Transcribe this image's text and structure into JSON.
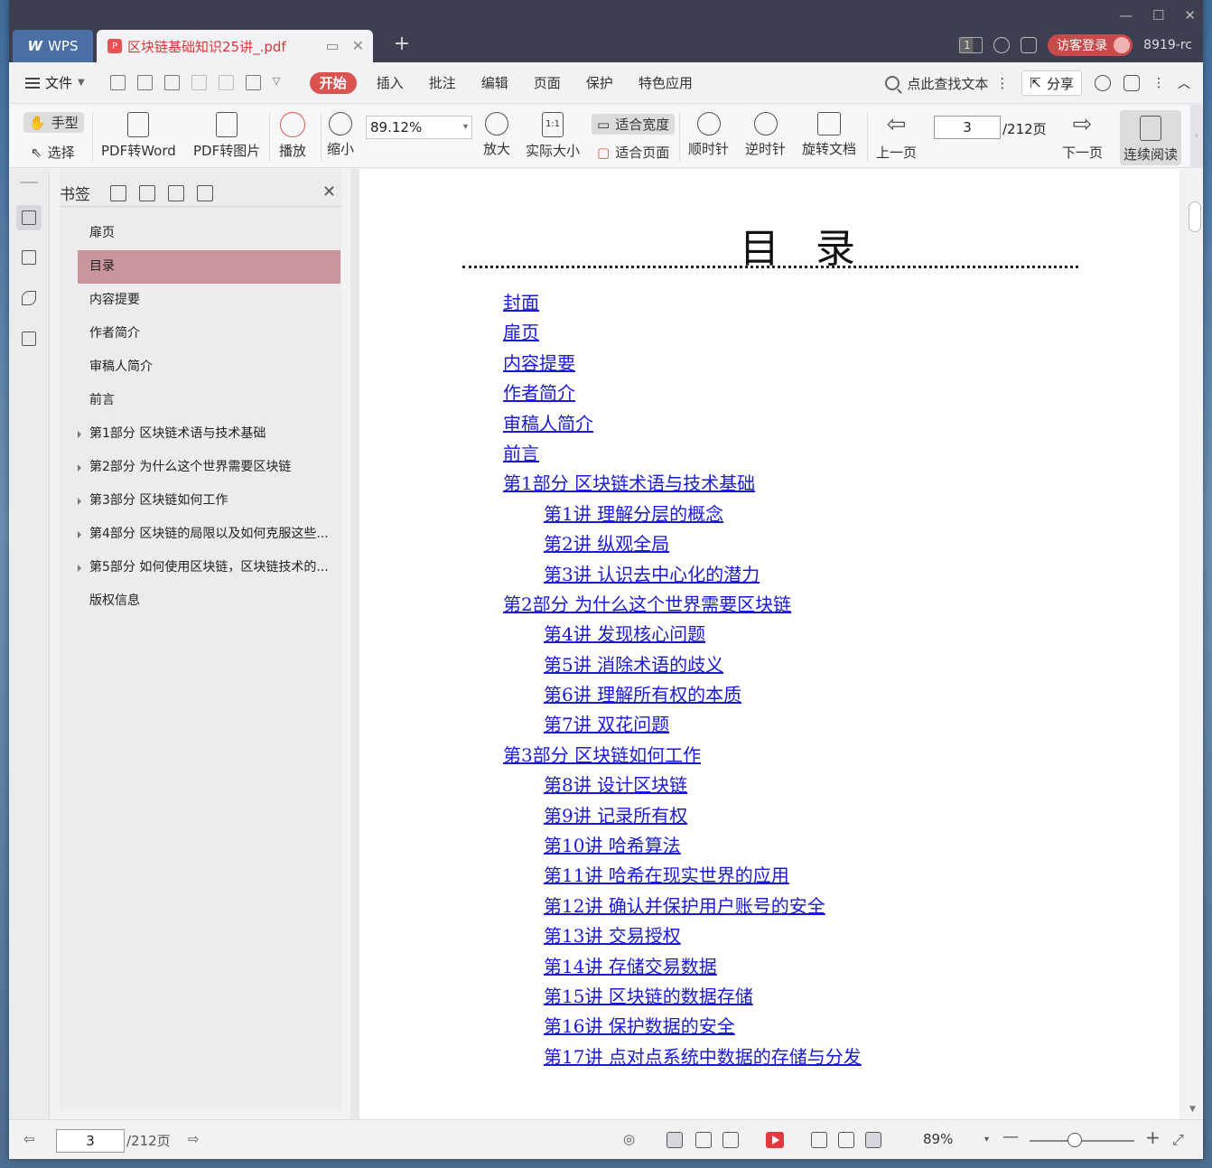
{
  "titlebar": {
    "app_tab": "WPS",
    "doc_tab": "区块链基础知识25讲_.pdf",
    "page_badge": "1",
    "login": "访客登录",
    "user": "8919-rc"
  },
  "menubar": {
    "file": "文件",
    "tabs": [
      "开始",
      "插入",
      "批注",
      "编辑",
      "页面",
      "保护",
      "特色应用"
    ],
    "find": "点此查找文本",
    "share": "分享"
  },
  "ribbon": {
    "hand": "手型",
    "select": "选择",
    "pdf_to_word": "PDF转Word",
    "pdf_to_image": "PDF转图片",
    "play": "播放",
    "zoom_out": "缩小",
    "zoom_value": "89.12%",
    "zoom_in": "放大",
    "actual_size": "实际大小",
    "fit_width": "适合宽度",
    "fit_page": "适合页面",
    "clockwise": "顺时针",
    "counterclockwise": "逆时针",
    "rotate_doc": "旋转文档",
    "prev_page": "上一页",
    "page_current": "3",
    "page_total": "/212页",
    "next_page": "下一页",
    "continuous": "连续阅读"
  },
  "bookmarks": {
    "title": "书签",
    "items": [
      {
        "label": "扉页"
      },
      {
        "label": "目录"
      },
      {
        "label": "内容提要"
      },
      {
        "label": "作者简介"
      },
      {
        "label": "审稿人简介"
      },
      {
        "label": "前言"
      },
      {
        "label": "第1部分 区块链术语与技术基础"
      },
      {
        "label": "第2部分 为什么这个世界需要区块链"
      },
      {
        "label": "第3部分 区块链如何工作"
      },
      {
        "label": "第4部分 区块链的局限以及如何克服这些..."
      },
      {
        "label": "第5部分 如何使用区块链，区块链技术的..."
      },
      {
        "label": "版权信息"
      }
    ]
  },
  "document": {
    "title": "目录",
    "toc": [
      {
        "text": "封面"
      },
      {
        "text": "扉页"
      },
      {
        "text": "内容提要"
      },
      {
        "text": "作者简介"
      },
      {
        "text": "审稿人简介"
      },
      {
        "text": "前言"
      },
      {
        "text": "第1部分  区块链术语与技术基础"
      },
      {
        "text": "第1讲  理解分层的概念"
      },
      {
        "text": "第2讲  纵观全局"
      },
      {
        "text": "第3讲  认识去中心化的潜力"
      },
      {
        "text": "第2部分  为什么这个世界需要区块链"
      },
      {
        "text": "第4讲  发现核心问题"
      },
      {
        "text": "第5讲  消除术语的歧义"
      },
      {
        "text": "第6讲  理解所有权的本质"
      },
      {
        "text": "第7讲  双花问题"
      },
      {
        "text": "第3部分  区块链如何工作"
      },
      {
        "text": "第8讲  设计区块链"
      },
      {
        "text": "第9讲  记录所有权"
      },
      {
        "text": "第10讲  哈希算法"
      },
      {
        "text": "第11讲  哈希在现实世界的应用"
      },
      {
        "text": "第12讲  确认并保护用户账号的安全"
      },
      {
        "text": "第13讲  交易授权"
      },
      {
        "text": "第14讲  存储交易数据"
      },
      {
        "text": "第15讲  区块链的数据存储"
      },
      {
        "text": "第16讲  保护数据的安全"
      },
      {
        "text": "第17讲  点对点系统中数据的存储与分发"
      }
    ]
  },
  "statusbar": {
    "page_current": "3",
    "page_total": "/212页",
    "zoom": "89%"
  },
  "colors": {
    "accent": "#d9534f",
    "link": "#1a1ad6",
    "bookmark_selected": "#c9969b"
  }
}
